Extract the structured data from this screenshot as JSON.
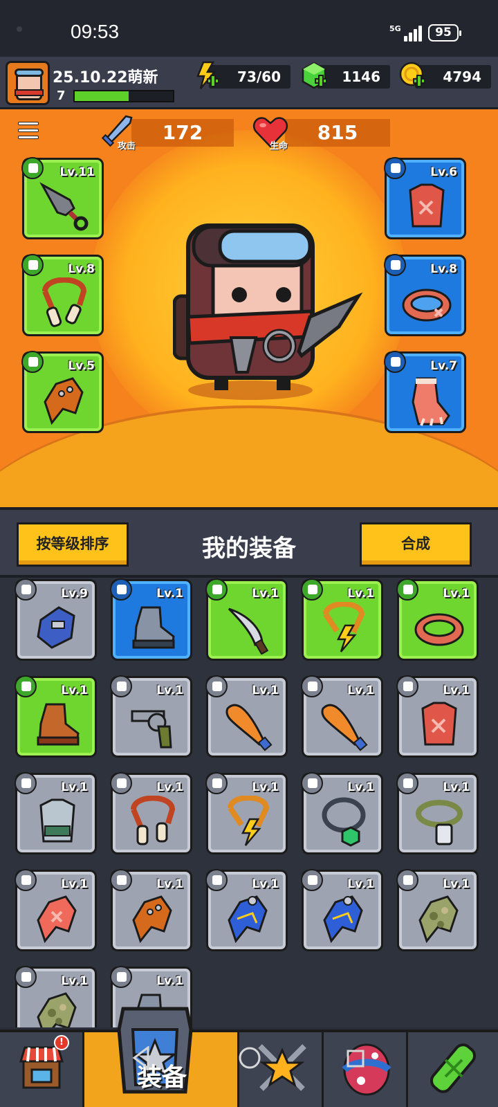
{
  "status_bar": {
    "time": "09:53",
    "network": "5G",
    "battery": "95"
  },
  "player": {
    "name": "25.10.22萌新",
    "level": "7",
    "xp_fraction": 0.55
  },
  "resources": [
    {
      "name": "energy",
      "icon": "lightning-icon",
      "value": "73/60",
      "color": "#ffcc1a"
    },
    {
      "name": "gems",
      "icon": "gem-icon",
      "value": "1146",
      "color": "#49d23a"
    },
    {
      "name": "coins",
      "icon": "coin-icon",
      "value": "4794",
      "color": "#ffcc1a"
    }
  ],
  "stats": {
    "attack": {
      "label": "攻击",
      "value": "172",
      "icon": "sword-icon"
    },
    "hp": {
      "label": "生命",
      "value": "815",
      "icon": "heart-icon"
    }
  },
  "equipped_left": [
    {
      "slot": "weapon",
      "level": "Lv.11",
      "item": "kunai",
      "rarity": "green"
    },
    {
      "slot": "necklace",
      "level": "Lv.8",
      "item": "bone-necklace",
      "rarity": "green"
    },
    {
      "slot": "gloves",
      "level": "Lv.5",
      "item": "leather-gloves",
      "rarity": "green"
    }
  ],
  "equipped_right": [
    {
      "slot": "armor",
      "level": "Lv.6",
      "item": "red-vest",
      "rarity": "blue"
    },
    {
      "slot": "belt",
      "level": "Lv.8",
      "item": "fur-belt",
      "rarity": "blue"
    },
    {
      "slot": "boots",
      "level": "Lv.7",
      "item": "fur-boots",
      "rarity": "blue"
    }
  ],
  "inventory_header": {
    "sort_button": "按等级排序",
    "title": "我的装备",
    "merge_button": "合成"
  },
  "inventory": [
    {
      "level": "Lv.9",
      "rarity": "grey",
      "item": "gauntlet",
      "slot": "gloves"
    },
    {
      "level": "Lv.1",
      "rarity": "blue",
      "item": "boot",
      "slot": "boots"
    },
    {
      "level": "Lv.1",
      "rarity": "green",
      "item": "machete",
      "slot": "weapon"
    },
    {
      "level": "Lv.1",
      "rarity": "green",
      "item": "lightning-necklace",
      "slot": "necklace"
    },
    {
      "level": "Lv.1",
      "rarity": "green",
      "item": "fur-belt",
      "slot": "belt"
    },
    {
      "level": "Lv.1",
      "rarity": "green",
      "item": "leather-boot",
      "slot": "boots"
    },
    {
      "level": "Lv.1",
      "rarity": "grey",
      "item": "revolver",
      "slot": "weapon"
    },
    {
      "level": "Lv.1",
      "rarity": "grey",
      "item": "bat",
      "slot": "weapon"
    },
    {
      "level": "Lv.1",
      "rarity": "grey",
      "item": "bat",
      "slot": "weapon"
    },
    {
      "level": "Lv.1",
      "rarity": "grey",
      "item": "red-vest",
      "slot": "armor"
    },
    {
      "level": "Lv.1",
      "rarity": "grey",
      "item": "steel-vest",
      "slot": "armor"
    },
    {
      "level": "Lv.1",
      "rarity": "grey",
      "item": "bone-necklace",
      "slot": "necklace"
    },
    {
      "level": "Lv.1",
      "rarity": "grey",
      "item": "lightning-necklace",
      "slot": "necklace"
    },
    {
      "level": "Lv.1",
      "rarity": "grey",
      "item": "emerald-necklace",
      "slot": "necklace"
    },
    {
      "level": "Lv.1",
      "rarity": "grey",
      "item": "dog-tag",
      "slot": "necklace"
    },
    {
      "level": "Lv.1",
      "rarity": "grey",
      "item": "red-glove",
      "slot": "gloves"
    },
    {
      "level": "Lv.1",
      "rarity": "grey",
      "item": "leather-gloves",
      "slot": "gloves"
    },
    {
      "level": "Lv.1",
      "rarity": "grey",
      "item": "blue-glove",
      "slot": "gloves"
    },
    {
      "level": "Lv.1",
      "rarity": "grey",
      "item": "blue-glove",
      "slot": "gloves"
    },
    {
      "level": "Lv.1",
      "rarity": "grey",
      "item": "camo-glove",
      "slot": "gloves"
    },
    {
      "level": "Lv.1",
      "rarity": "grey",
      "item": "camo-glove",
      "slot": "gloves"
    },
    {
      "level": "Lv.1",
      "rarity": "grey",
      "item": "boot",
      "slot": "boots"
    }
  ],
  "nav": {
    "tabs": [
      {
        "name": "shop",
        "icon": "shop-icon",
        "badge": "!"
      },
      {
        "name": "equipment",
        "icon": "armor-icon",
        "label": "装备",
        "active": true
      },
      {
        "name": "battle",
        "icon": "star-swords-icon"
      },
      {
        "name": "egg",
        "icon": "egg-icon"
      },
      {
        "name": "gene",
        "icon": "dna-capsule-icon"
      }
    ]
  },
  "colors": {
    "hero_bg": "#f5821c",
    "green_rarity": "#6fd630",
    "blue_rarity": "#1f7ae0",
    "grey_rarity": "#9da3b1",
    "button_yellow": "#ffc21a"
  }
}
